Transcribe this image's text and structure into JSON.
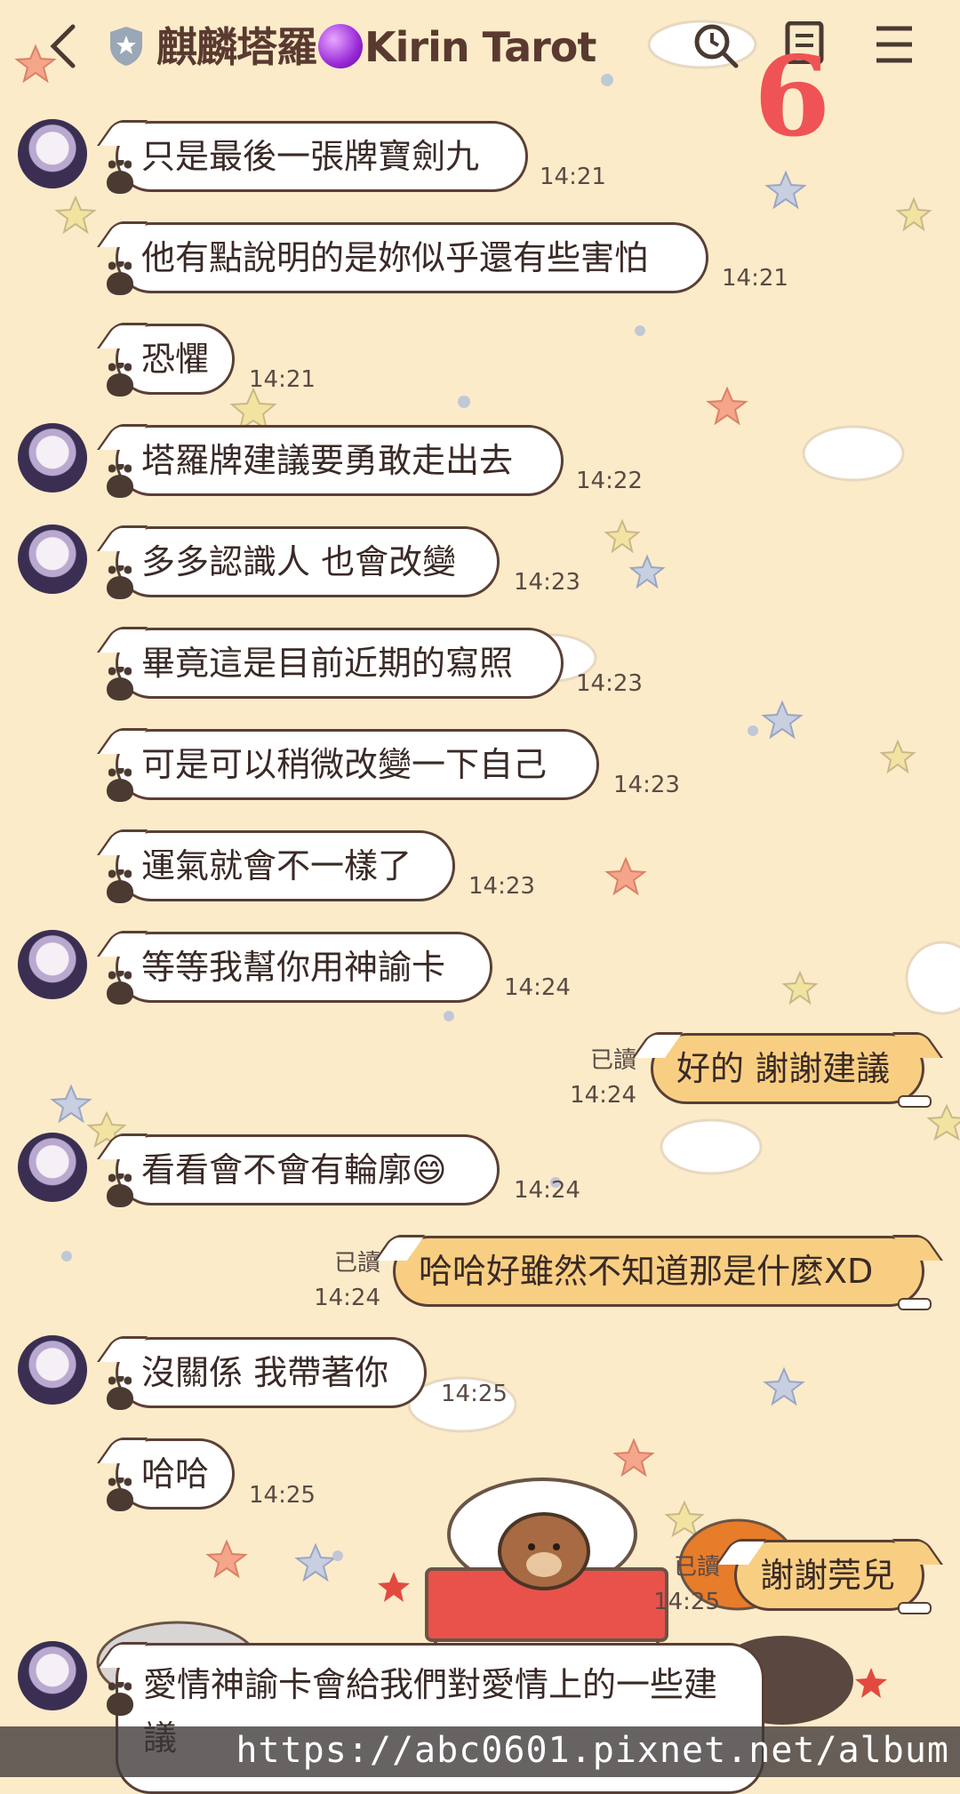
{
  "header": {
    "title_part1": "麒麟塔羅",
    "title_part2": "Kirin Tarot",
    "back_icon": "chevron-left-icon",
    "shield_icon": "shield-star-icon",
    "search_icon": "search-icon",
    "notes_icon": "notes-icon",
    "menu_icon": "hamburger-menu-icon",
    "page_number": "6"
  },
  "messages": [
    {
      "text": "只是最後一張牌寶劍九",
      "time": "14:21"
    },
    {
      "text": "他有點說明的是妳似乎還有些害怕",
      "time": "14:21"
    },
    {
      "text": "恐懼",
      "time": "14:21"
    },
    {
      "text": "塔羅牌建議要勇敢走出去",
      "time": "14:22"
    },
    {
      "text": "多多認識人 也會改變",
      "time": "14:23"
    },
    {
      "text": "畢竟這是目前近期的寫照",
      "time": "14:23"
    },
    {
      "text": "可是可以稍微改變一下自己",
      "time": "14:23"
    },
    {
      "text": "運氣就會不一樣了",
      "time": "14:23"
    },
    {
      "text": "等等我幫你用神諭卡",
      "time": "14:24"
    },
    {
      "text": "好的 謝謝建議",
      "time": "14:24",
      "read": "已讀"
    },
    {
      "text": "看看會不會有輪廓😄",
      "time": "14:24"
    },
    {
      "text": "哈哈好雖然不知道那是什麼XD",
      "time": "14:24",
      "read": "已讀"
    },
    {
      "text": "沒關係 我帶著你",
      "time": "14:25"
    },
    {
      "text": "哈哈",
      "time": "14:25"
    },
    {
      "text": "謝謝莞兒",
      "time": "14:25",
      "read": "已讀"
    },
    {
      "text": "愛情神諭卡會給我們對愛情上的一些建議"
    }
  ],
  "watermark": "https://abc0601.pixnet.net/album",
  "colors": {
    "background": "#fcebc9",
    "incoming_bubble": "#ffffff",
    "outgoing_bubble": "#f8cf82",
    "bubble_border": "#5a3f35",
    "page_number": "#ef5355"
  }
}
